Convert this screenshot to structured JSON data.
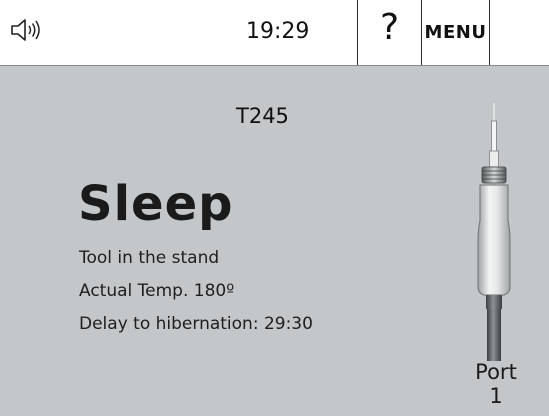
{
  "topbar": {
    "speaker_icon": "speaker-sound-icon",
    "time": "19:29",
    "help_label": "?",
    "menu_label": "MENU"
  },
  "main": {
    "tool_model": "T245",
    "status": "Sleep",
    "info": {
      "tool_state": "Tool in the stand",
      "actual_temp": "Actual Temp. 180º",
      "hibernation_delay": "Delay to hibernation: 29:30"
    },
    "port_label": "Port",
    "port_number": "1",
    "iron_icon": "soldering-iron-icon"
  },
  "colors": {
    "topbar_bg": "#ffffff",
    "main_bg": "#c4c7c9",
    "separator": "#2a2a2a"
  }
}
